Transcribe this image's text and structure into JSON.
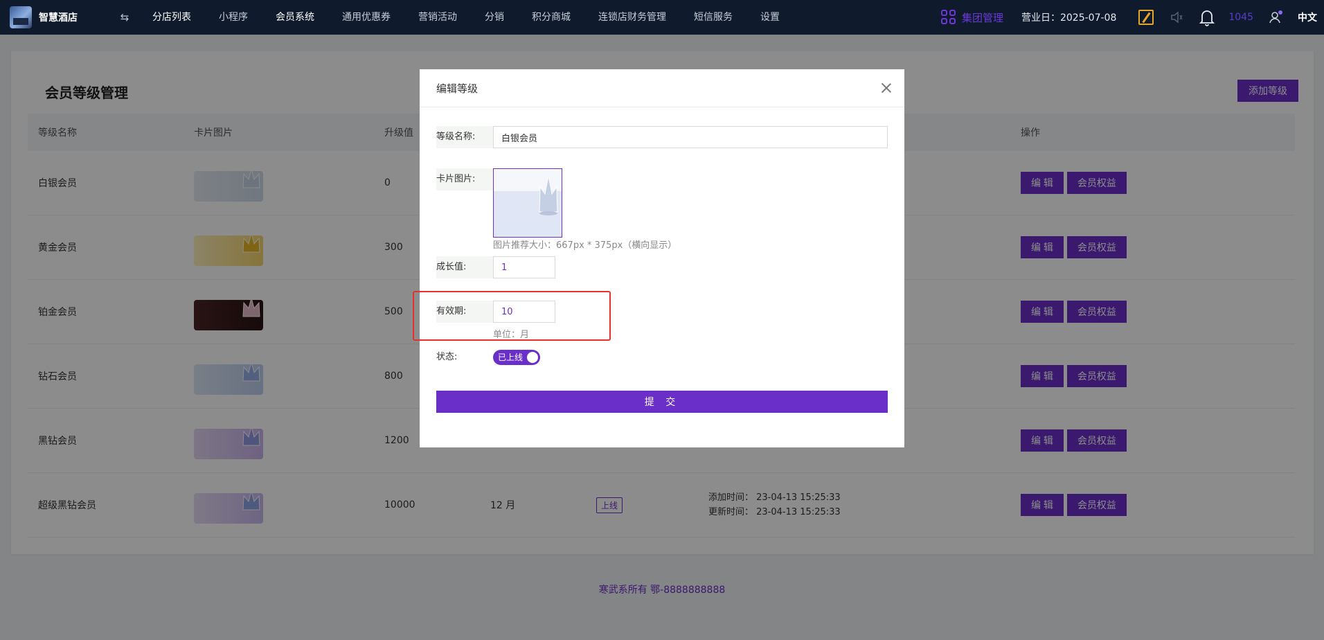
{
  "topbar": {
    "logo_text": "智慧酒店",
    "swap_icon": "⇆",
    "nav": [
      "分店列表",
      "小程序",
      "会员系统",
      "通用优惠券",
      "营销活动",
      "分销",
      "积分商城",
      "连锁店财务管理",
      "短信服务",
      "设置"
    ],
    "group_label": "集团管理",
    "business_day": "营业日：2025-07-08",
    "count": "1045",
    "lang": "中文"
  },
  "page": {
    "title": "会员等级管理",
    "add_button": "添加等级",
    "columns": {
      "name": "等级名称",
      "image": "卡片图片",
      "upgrade": "升级值",
      "ops": "操作"
    },
    "rows": [
      {
        "name": "白银会员",
        "value": "0",
        "tone": [
          "#e5ebf3",
          "#cdd9e8"
        ],
        "crown": "#c9d3e6"
      },
      {
        "name": "黄金会员",
        "value": "300",
        "tone": [
          "#fdf0bc",
          "#f6d46a"
        ],
        "crown": "#e8b824"
      },
      {
        "name": "铂金会员",
        "value": "500",
        "tone": [
          "#4a2424",
          "#2a1414"
        ],
        "crown": "#e8b8c8"
      },
      {
        "name": "钻石会员",
        "value": "800",
        "tone": [
          "#dde6f6",
          "#bccdee"
        ],
        "crown": "#98aee6"
      },
      {
        "name": "黑钻会员",
        "value": "1200",
        "tone": [
          "#e5d6f4",
          "#c9b2ec"
        ],
        "crown": "#8e9ae0"
      },
      {
        "name": "超级黑钻会员",
        "value": "10000",
        "tone": [
          "#e8dcf6",
          "#c8b8ee"
        ],
        "crown": "#8ea2e6",
        "period": "12 月",
        "status": "上线",
        "added": "添加时间：  23-04-13 15:25:33",
        "updated": "更新时间：  23-04-13 15:25:33"
      }
    ],
    "edit_label": "编 辑",
    "rights_label": "会员权益",
    "footer": "寒武系所有 鄂-8888888888"
  },
  "modal": {
    "title": "编辑等级",
    "name_label": "等级名称:",
    "name_value": "白银会员",
    "image_label": "卡片图片:",
    "image_hint": "图片推荐大小：667px * 375px（横向显示）",
    "growth_label": "成长值:",
    "growth_value": "1",
    "period_label": "有效期:",
    "period_value": "10",
    "period_unit": "单位：月",
    "status_label": "状态:",
    "status_value": "已上线",
    "submit": "提 交"
  },
  "colors": {
    "accent": "#6b2fc9",
    "topbar": "#0f1b2d",
    "highlight": "#e2322b"
  }
}
